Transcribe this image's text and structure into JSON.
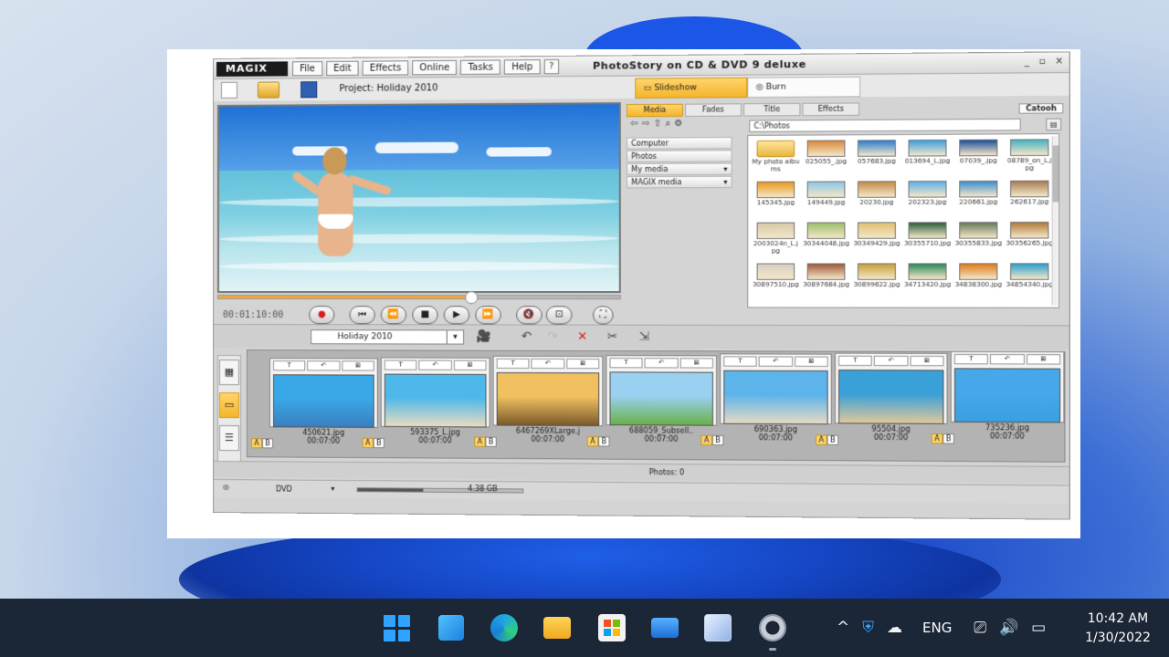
{
  "app": {
    "logo": "MAGIX",
    "title": "PhotoStory on CD & DVD 9 deluxe",
    "menu": [
      "File",
      "Edit",
      "Effects",
      "Online",
      "Tasks",
      "Help"
    ],
    "window_controls": [
      "_",
      "▫",
      "×"
    ],
    "project_label": "Project: Holiday 2010",
    "mode_tabs": [
      {
        "label": "Slideshow",
        "active": true
      },
      {
        "label": "Burn",
        "active": false
      }
    ]
  },
  "preview": {
    "timecode": "00:01:10:00",
    "scrub_fraction": 0.63
  },
  "browser": {
    "tabs": [
      {
        "label": "Media",
        "active": true
      },
      {
        "label": "Fades",
        "active": false
      },
      {
        "label": "Title",
        "active": false
      },
      {
        "label": "Effects",
        "active": false
      }
    ],
    "right_label": "Catooh",
    "path": "C:\\Photos",
    "sources": [
      {
        "label": "Computer",
        "expandable": false
      },
      {
        "label": "Photos",
        "expandable": false
      },
      {
        "label": "My media",
        "expandable": true
      },
      {
        "label": "MAGIX media",
        "expandable": true
      }
    ],
    "files": [
      {
        "name": "My photo albums",
        "folder": true,
        "color": "#e8b640"
      },
      {
        "name": "025055_.jpg",
        "folder": false,
        "color": "#d88a3a"
      },
      {
        "name": "057683.jpg",
        "folder": false,
        "color": "#2a7fd0"
      },
      {
        "name": "013694_L.jpg",
        "folder": false,
        "color": "#3aa0e0"
      },
      {
        "name": "07039_.jpg",
        "folder": false,
        "color": "#1d4f9a"
      },
      {
        "name": "08789_on_L.jpg",
        "folder": false,
        "color": "#46b2c0"
      },
      {
        "name": "145345.jpg",
        "folder": false,
        "color": "#e89a1c"
      },
      {
        "name": "149449.jpg",
        "folder": false,
        "color": "#8ec6e6"
      },
      {
        "name": "20230.jpg",
        "folder": false,
        "color": "#c48a4a"
      },
      {
        "name": "202323.jpg",
        "folder": false,
        "color": "#5fb0e6"
      },
      {
        "name": "220661.jpg",
        "folder": false,
        "color": "#3d8fd0"
      },
      {
        "name": "262617.jpg",
        "folder": false,
        "color": "#a67d54"
      },
      {
        "name": "2003024n_L.jpg",
        "folder": false,
        "color": "#d8c8a8"
      },
      {
        "name": "30344048.jpg",
        "folder": false,
        "color": "#9bbf6a"
      },
      {
        "name": "30349429.jpg",
        "folder": false,
        "color": "#e0c070"
      },
      {
        "name": "30355710.jpg",
        "folder": false,
        "color": "#2d5f3a"
      },
      {
        "name": "30355833.jpg",
        "folder": false,
        "color": "#6a7a5a"
      },
      {
        "name": "30356265.jpg",
        "folder": false,
        "color": "#b07a3a"
      },
      {
        "name": "30897510.jpg",
        "folder": false,
        "color": "#d6d0c0"
      },
      {
        "name": "30897684.jpg",
        "folder": false,
        "color": "#a05a3a"
      },
      {
        "name": "30899622.jpg",
        "folder": false,
        "color": "#c8a03a"
      },
      {
        "name": "34713420.jpg",
        "folder": false,
        "color": "#2a8a5a"
      },
      {
        "name": "34838300.jpg",
        "folder": false,
        "color": "#e07a1a"
      },
      {
        "name": "34854340.jpg",
        "folder": false,
        "color": "#2aa0d0"
      }
    ]
  },
  "storyboard": {
    "selector": "Holiday 2010",
    "card_tools": [
      "T",
      "↶",
      "⊠"
    ],
    "items": [
      {
        "file": "450621.jpg",
        "duration": "00:07:00",
        "sky": "#39a8e6",
        "ground": "#3a7fc0"
      },
      {
        "file": "593375_L.jpg",
        "duration": "00:07:00",
        "sky": "#4fb8ea",
        "ground": "#e8dcc0"
      },
      {
        "file": "6467269XLarge.j",
        "duration": "00:07:00",
        "sky": "#f0c060",
        "ground": "#7a5a2a"
      },
      {
        "file": "688059_Subsell..",
        "duration": "00:07:00",
        "sky": "#9ad0f0",
        "ground": "#6ab04a"
      },
      {
        "file": "690363.jpg",
        "duration": "00:07:00",
        "sky": "#5cb4ea",
        "ground": "#e6dac4"
      },
      {
        "file": "95504.jpg",
        "duration": "00:07:00",
        "sky": "#3aa0d8",
        "ground": "#e0c89a"
      },
      {
        "file": "735236.jpg",
        "duration": "00:07:00",
        "sky": "#46a8e8",
        "ground": "#3aa0e0"
      }
    ],
    "transition_a": "A",
    "transition_b": "B"
  },
  "status": {
    "photos": "Photos: 0",
    "medium": "DVD",
    "size": "4.38 GB"
  },
  "taskbar": {
    "apps": [
      "start-icon",
      "widgets-icon",
      "edge-icon",
      "file-explorer-icon",
      "store-icon",
      "mail-icon",
      "paint-icon",
      "settings-icon"
    ],
    "language": "ENG",
    "time": "10:42 AM",
    "date": "1/30/2022"
  }
}
